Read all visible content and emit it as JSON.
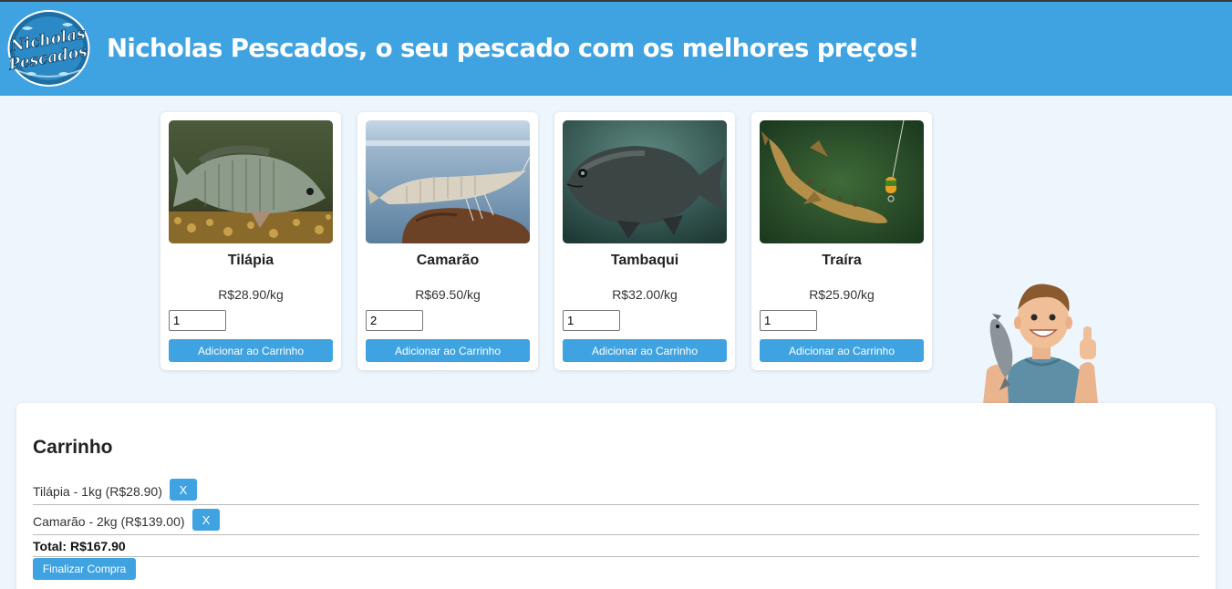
{
  "header": {
    "logo_text": "Nicholas Pescados",
    "title": "Nicholas Pescados, o seu pescado com os melhores preços!"
  },
  "products": [
    {
      "name": "Tilápia",
      "price": "R$28.90/kg",
      "quantity": "1",
      "button_label": "Adicionar ao Carrinho",
      "image": "tilapia-photo"
    },
    {
      "name": "Camarão",
      "price": "R$69.50/kg",
      "quantity": "2",
      "button_label": "Adicionar ao Carrinho",
      "image": "shrimp-photo"
    },
    {
      "name": "Tambaqui",
      "price": "R$32.00/kg",
      "quantity": "1",
      "button_label": "Adicionar ao Carrinho",
      "image": "tambaqui-photo"
    },
    {
      "name": "Traíra",
      "price": "R$25.90/kg",
      "quantity": "1",
      "button_label": "Adicionar ao Carrinho",
      "image": "traira-photo"
    }
  ],
  "cart": {
    "title": "Carrinho",
    "items": [
      {
        "text": "Tilápia - 1kg (R$28.90)",
        "remove_label": "X"
      },
      {
        "text": "Camarão - 2kg (R$139.00)",
        "remove_label": "X"
      }
    ],
    "total": "Total: R$167.90",
    "finalize_label": "Finalizar Compra"
  },
  "colors": {
    "header_bg": "#3fa3e2",
    "page_bg": "#eef6fd",
    "button_bg": "#3fa3e2"
  }
}
